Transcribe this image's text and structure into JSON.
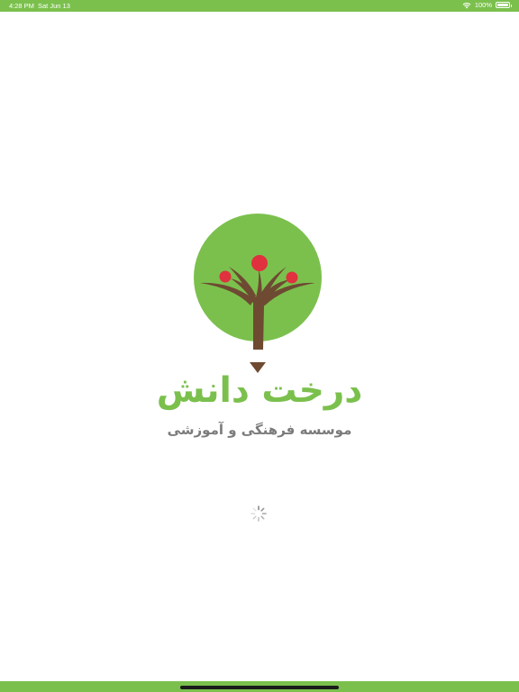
{
  "status_bar": {
    "time": "4:28 PM",
    "date": "Sat Jun 13",
    "battery": "100%",
    "battery_level": 1.0,
    "icons": [
      "wifi-icon",
      "battery-icon"
    ]
  },
  "splash": {
    "brand_name": "درخت دانش",
    "subtitle": "موسسه فرهنگی و آموزشی",
    "loading": true
  },
  "colors": {
    "brand_green": "#7bc04d",
    "trunk_brown": "#6e4a32",
    "fruit_red": "#e0313f",
    "subtitle_gray": "#7b7b7b"
  }
}
